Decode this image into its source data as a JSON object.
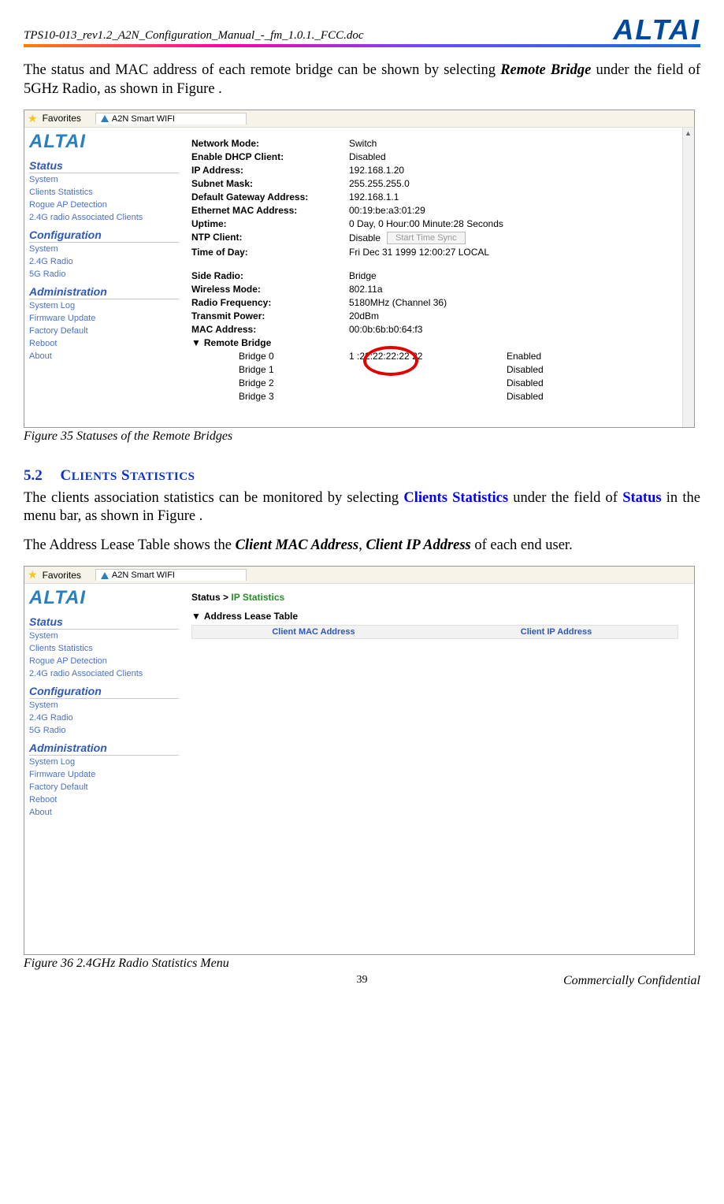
{
  "doc_header": "TPS10-013_rev1.2_A2N_Configuration_Manual_-_fm_1.0.1._FCC.doc",
  "brand": "ALTAI",
  "intro_text": {
    "p1a": "The status and MAC address of each remote bridge can be shown by selecting ",
    "p1b": "Remote Bridge",
    "p1c": " under the field of 5GHz Radio, as shown in Figure ."
  },
  "shot1": {
    "favorites": "Favorites",
    "tab": "A2N Smart WIFI",
    "logo": "ALTAI",
    "nav": {
      "status": "Status",
      "status_items": [
        "System",
        "Clients Statistics",
        "Rogue AP Detection",
        "2.4G radio Associated Clients"
      ],
      "config": "Configuration",
      "config_items": [
        "System",
        "2.4G Radio",
        "5G Radio"
      ],
      "admin": "Administration",
      "admin_items": [
        "System Log",
        "Firmware Update",
        "Factory Default",
        "Reboot",
        "About"
      ]
    },
    "fields": {
      "network_mode": {
        "label": "Network Mode:",
        "value": "Switch"
      },
      "dhcp": {
        "label": "Enable DHCP Client:",
        "value": "Disabled"
      },
      "ip": {
        "label": "IP Address:",
        "value": "192.168.1.20"
      },
      "mask": {
        "label": "Subnet Mask:",
        "value": "255.255.255.0"
      },
      "gw": {
        "label": "Default Gateway Address:",
        "value": "192.168.1.1"
      },
      "mac": {
        "label": "Ethernet MAC Address:",
        "value": "00:19:be:a3:01:29"
      },
      "uptime": {
        "label": "Uptime:",
        "value": "0 Day, 0 Hour:00 Minute:28 Seconds"
      },
      "ntp": {
        "label": "NTP Client:",
        "value": "Disable",
        "btn": "Start Time Sync"
      },
      "tod": {
        "label": "Time of Day:",
        "value": "Fri Dec 31 1999 12:00:27 LOCAL"
      },
      "side_radio": {
        "label": "Side Radio:",
        "value": "Bridge"
      },
      "wmode": {
        "label": "Wireless Mode:",
        "value": "802.11a"
      },
      "freq": {
        "label": "Radio Frequency:",
        "value": "5180MHz (Channel 36)"
      },
      "tx": {
        "label": "Transmit Power:",
        "value": "20dBm"
      },
      "mac5": {
        "label": "MAC Address:",
        "value": "00:0b:6b:b0:64:f3"
      }
    },
    "remote_bridge": "Remote Bridge",
    "bridges": [
      {
        "name": "Bridge 0",
        "mac": "1 :22:22:22:22 22",
        "state": "Enabled"
      },
      {
        "name": "Bridge 1",
        "mac": "",
        "state": "Disabled"
      },
      {
        "name": "Bridge 2",
        "mac": "",
        "state": "Disabled"
      },
      {
        "name": "Bridge 3",
        "mac": "",
        "state": "Disabled"
      }
    ]
  },
  "fig35": "Figure 35     Statuses of the Remote Bridges",
  "sec52": {
    "num": "5.2",
    "title": "CLIENTS STATISTICS"
  },
  "p52a": "The clients association statistics can be monitored by selecting ",
  "p52b": "Clients Statistics",
  "p52c": " under the field of ",
  "p52d": "Status",
  "p52e": " in the menu bar, as shown in Figure .",
  "p52f": "The Address Lease Table shows the ",
  "p52g": "Client MAC Address",
  "p52h": ", ",
  "p52i": "Client IP Address",
  "p52j": " of each end user.",
  "shot2": {
    "favorites": "Favorites",
    "tab": "A2N Smart WIFI",
    "logo": "ALTAI",
    "breadcrumb_a": "Status > ",
    "breadcrumb_b": "IP Statistics",
    "addr_table": "Address Lease Table",
    "th1": "Client MAC Address",
    "th2": "Client IP Address",
    "nav": {
      "status": "Status",
      "status_items": [
        "System",
        "Clients Statistics",
        "Rogue AP Detection",
        "2.4G radio Associated Clients"
      ],
      "config": "Configuration",
      "config_items": [
        "System",
        "2.4G Radio",
        "5G Radio"
      ],
      "admin": "Administration",
      "admin_items": [
        "System Log",
        "Firmware Update",
        "Factory Default",
        "Reboot",
        "About"
      ]
    }
  },
  "fig36": "Figure 36     2.4GHz Radio Statistics Menu",
  "page_num": "39",
  "confidential": "Commercially Confidential"
}
